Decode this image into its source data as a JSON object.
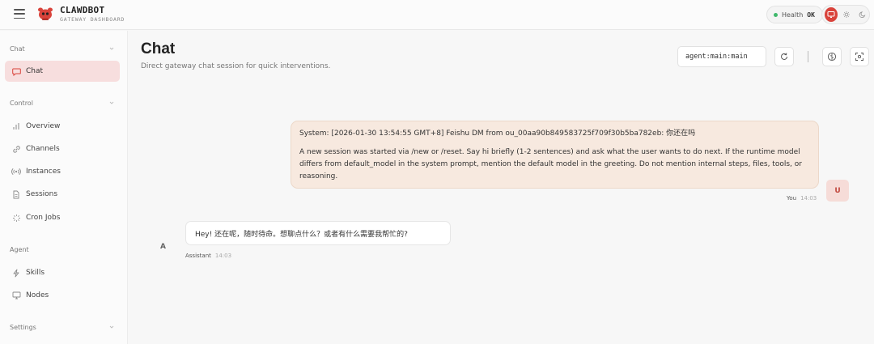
{
  "app": {
    "title": "CLAWDBOT",
    "subtitle": "GATEWAY DASHBOARD"
  },
  "topbar": {
    "health_label": "Health",
    "health_value": "OK",
    "health_color": "#3fb86b",
    "accent_color": "#d9433b",
    "theme_icons": [
      "monitor-icon",
      "sun-icon",
      "moon-icon"
    ]
  },
  "sidebar": {
    "groups": [
      {
        "label": "Chat",
        "items": [
          {
            "label": "Chat",
            "icon": "chat-bubble-icon",
            "active": true
          }
        ]
      },
      {
        "label": "Control",
        "items": [
          {
            "label": "Overview",
            "icon": "bar-chart-icon"
          },
          {
            "label": "Channels",
            "icon": "link-icon"
          },
          {
            "label": "Instances",
            "icon": "radio-icon"
          },
          {
            "label": "Sessions",
            "icon": "document-icon"
          },
          {
            "label": "Cron Jobs",
            "icon": "loader-icon"
          }
        ]
      },
      {
        "label": "Agent",
        "items": [
          {
            "label": "Skills",
            "icon": "bolt-icon"
          },
          {
            "label": "Nodes",
            "icon": "monitor-icon"
          }
        ]
      },
      {
        "label": "Settings",
        "items": []
      }
    ]
  },
  "main": {
    "title": "Chat",
    "subtitle": "Direct gateway chat session for quick interventions.",
    "session_value": "agent:main:main"
  },
  "messages": [
    {
      "role": "user",
      "line1": "System: [2026-01-30 13:54:55 GMT+8] Feishu DM from ou_00aa90b849583725f709f30b5ba782eb: 你还在吗",
      "line2": "A new session was started via /new or /reset. Say hi briefly (1-2 sentences) and ask what the user wants to do next. If the runtime model differs from default_model in the system prompt, mention the default model in the greeting. Do not mention internal steps, files, tools, or reasoning.",
      "avatar": "U",
      "sender": "You",
      "time": "14:03"
    },
    {
      "role": "assistant",
      "text": "Hey! 还在呢，随时待命。想聊点什么？或者有什么需要我帮忙的?",
      "avatar": "A",
      "sender": "Assistant",
      "time": "14:03"
    }
  ]
}
